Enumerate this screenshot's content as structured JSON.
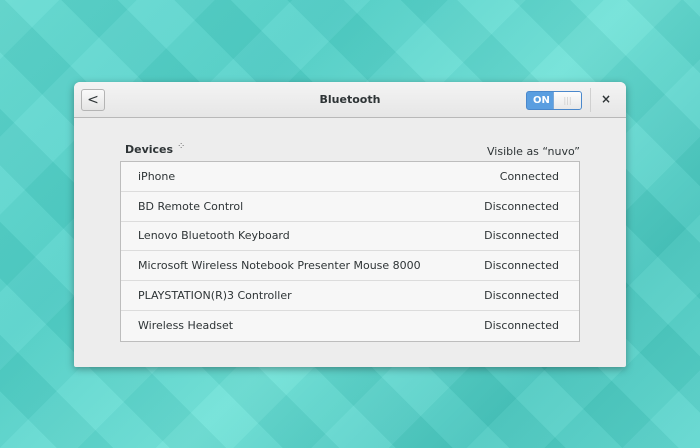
{
  "window": {
    "title": "Bluetooth",
    "switch_label": "ON",
    "back": "<",
    "close": "×"
  },
  "devices_label": "Devices",
  "visible_as": "Visible as “nuvo”",
  "devices": [
    {
      "name": "iPhone",
      "status": "Connected"
    },
    {
      "name": "BD Remote Control",
      "status": "Disconnected"
    },
    {
      "name": "Lenovo Bluetooth Keyboard",
      "status": "Disconnected"
    },
    {
      "name": "Microsoft Wireless Notebook Presenter Mouse 8000",
      "status": "Disconnected"
    },
    {
      "name": "PLAYSTATION(R)3 Controller",
      "status": "Disconnected"
    },
    {
      "name": "Wireless Headset",
      "status": "Disconnected"
    }
  ]
}
